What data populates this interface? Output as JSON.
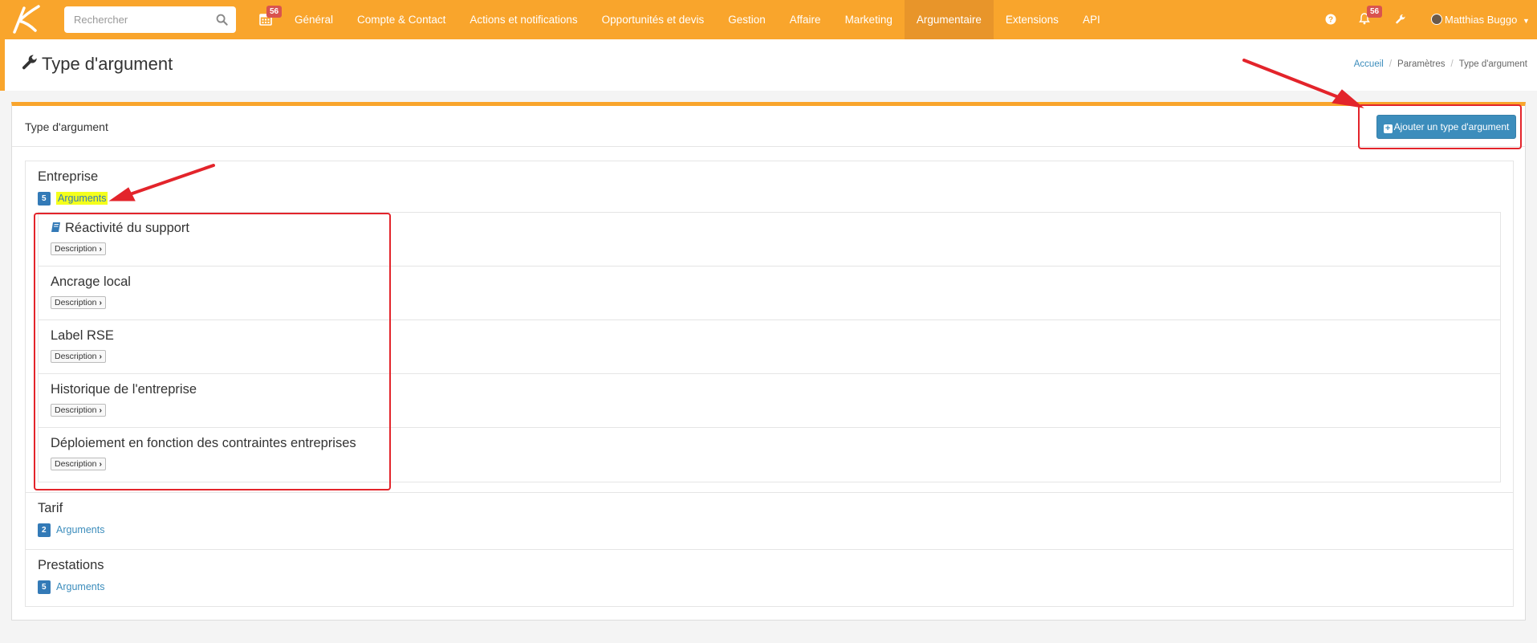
{
  "navbar": {
    "search_placeholder": "Rechercher",
    "calendar_badge": "56",
    "items": [
      {
        "label": "Général"
      },
      {
        "label": "Compte & Contact"
      },
      {
        "label": "Actions et notifications"
      },
      {
        "label": "Opportunités et devis"
      },
      {
        "label": "Gestion"
      },
      {
        "label": "Affaire"
      },
      {
        "label": "Marketing"
      },
      {
        "label": "Argumentaire"
      },
      {
        "label": "Extensions"
      },
      {
        "label": "API"
      }
    ],
    "active_item": "Argumentaire",
    "notification_badge": "56",
    "user_name": "Matthias Buggo"
  },
  "header": {
    "title": "Type d'argument",
    "breadcrumb": {
      "home": "Accueil",
      "settings": "Paramètres",
      "current": "Type d'argument"
    }
  },
  "panel": {
    "title": "Type d'argument",
    "add_button_label": "Ajouter un type d'argument"
  },
  "groups": [
    {
      "name": "Entreprise",
      "count": "5",
      "link_label": "Arguments",
      "items": [
        {
          "title": "Réactivité du support",
          "button": "Description"
        },
        {
          "title": "Ancrage local",
          "button": "Description"
        },
        {
          "title": "Label RSE",
          "button": "Description"
        },
        {
          "title": "Historique de l'entreprise",
          "button": "Description"
        },
        {
          "title": "Déploiement en fonction des contraintes entreprises",
          "button": "Description"
        }
      ]
    },
    {
      "name": "Tarif",
      "count": "2",
      "link_label": "Arguments"
    },
    {
      "name": "Prestations",
      "count": "5",
      "link_label": "Arguments"
    }
  ],
  "colors": {
    "navbar": "#f9a52c",
    "active_nav": "#e8952a",
    "primary_button": "#3c8dbc",
    "count_badge": "#337ab7",
    "highlight": "#f4ff1c",
    "annotation": "#e3242b"
  },
  "icons": [
    "logo-icon",
    "search-icon",
    "calendar-icon",
    "help-icon",
    "bell-icon",
    "wrench-icon",
    "book-icon",
    "chevron-right-icon",
    "plus-square-icon",
    "caret-down-icon"
  ]
}
